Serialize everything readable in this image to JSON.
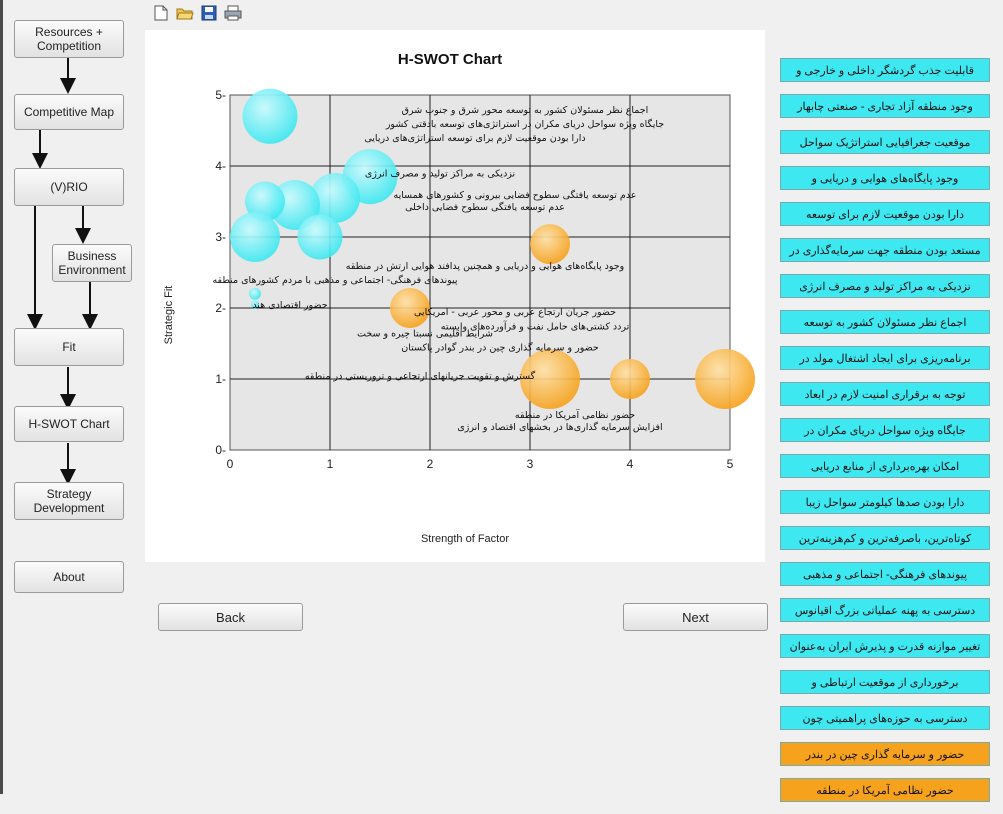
{
  "toolbar": {
    "icons": [
      "new-file-icon",
      "open-folder-icon",
      "save-icon",
      "print-icon"
    ]
  },
  "nav": {
    "resources": "Resources + Competition",
    "competitive_map": "Competitive Map",
    "vrio": "(V)RIO",
    "business_env": "Business Environment",
    "fit": "Fit",
    "hswot": "H-SWOT Chart",
    "strategy": "Strategy Development",
    "about": "About"
  },
  "buttons": {
    "back": "Back",
    "next": "Next"
  },
  "colors": {
    "cyan_bubble": "#3ee8f0",
    "orange_bubble": "#f6a21c",
    "plot_bg": "#e6e6e6"
  },
  "chart_data": {
    "type": "scatter",
    "title": "H-SWOT Chart",
    "xlabel": "Strength of Factor",
    "ylabel": "Strategic Fit",
    "xlim": [
      0,
      5
    ],
    "ylim": [
      0,
      5
    ],
    "xticks": [
      "0",
      "1",
      "2",
      "3",
      "4",
      "5"
    ],
    "yticks": [
      "0-",
      "1-",
      "2-",
      "3-",
      "4-",
      "5-"
    ],
    "grid": true,
    "points": [
      {
        "x": 0.4,
        "y": 4.7,
        "size": 0.55,
        "group": "cyan"
      },
      {
        "x": 1.4,
        "y": 3.85,
        "size": 0.55,
        "group": "cyan"
      },
      {
        "x": 1.05,
        "y": 3.55,
        "size": 0.5,
        "group": "cyan"
      },
      {
        "x": 0.65,
        "y": 3.45,
        "size": 0.5,
        "group": "cyan"
      },
      {
        "x": 0.35,
        "y": 3.5,
        "size": 0.4,
        "group": "cyan"
      },
      {
        "x": 0.25,
        "y": 3.0,
        "size": 0.5,
        "group": "cyan"
      },
      {
        "x": 0.9,
        "y": 3.0,
        "size": 0.45,
        "group": "cyan"
      },
      {
        "x": 0.25,
        "y": 2.2,
        "size": 0.12,
        "group": "cyan"
      },
      {
        "x": 0.25,
        "y": 2.05,
        "size": 0.08,
        "group": "cyan"
      },
      {
        "x": 3.2,
        "y": 2.9,
        "size": 0.4,
        "group": "orange"
      },
      {
        "x": 1.8,
        "y": 2.0,
        "size": 0.4,
        "group": "orange"
      },
      {
        "x": 3.2,
        "y": 1.0,
        "size": 0.6,
        "group": "orange"
      },
      {
        "x": 4.0,
        "y": 1.0,
        "size": 0.4,
        "group": "orange"
      },
      {
        "x": 4.95,
        "y": 1.0,
        "size": 0.6,
        "group": "orange"
      }
    ],
    "annotations": [
      {
        "text": "اجماع نظر مسئولان کشور به توسعه محور شرق و جنوب شرق",
        "x": 2.95,
        "y": 4.75
      },
      {
        "text": "جایگاه ویژه سواحل دریای مکران در استراتژی‌های توسعه بادقتی کشور",
        "x": 2.95,
        "y": 4.55
      },
      {
        "text": "دارا بودن موقعیت لازم برای توسعه استراتژی‌های دریایی",
        "x": 2.45,
        "y": 4.35
      },
      {
        "text": "نزدیکی به مراکز تولید و مصرف انرژی",
        "x": 2.1,
        "y": 3.85
      },
      {
        "text": "عدم توسعه یافتگی سطوح فضایی بیرونی و کشورهای همسایه",
        "x": 2.85,
        "y": 3.55
      },
      {
        "text": "عدم توسعه یافتگی سطوح فضایی داخلی",
        "x": 2.55,
        "y": 3.38
      },
      {
        "text": "وجود پایگاه‌های هوایی و دریایی و همچنین پدافند هوایی ارتش در منطقه",
        "x": 2.55,
        "y": 2.55
      },
      {
        "text": "پیوندهای فرهنگی- اجتماعی و مذهبی با مردم کشورهای منطقه",
        "x": 1.05,
        "y": 2.35
      },
      {
        "text": "حضور جریان ارتجاع عربی و محور عربی - امریکایی",
        "x": 2.85,
        "y": 1.9
      },
      {
        "text": "تردد کشتی‌های حامل نفت و فرآورده‌های وابسته",
        "x": 3.05,
        "y": 1.7
      },
      {
        "text": "حضور اقتصادی هند",
        "x": 0.6,
        "y": 2.0
      },
      {
        "text": "شرایط اقلیمی نسبتا چیره و سخت",
        "x": 1.95,
        "y": 1.6
      },
      {
        "text": "حضور و سرمایه گذاری چین در بندر گوادر پاکستان",
        "x": 2.7,
        "y": 1.4
      },
      {
        "text": "گسترش و تقویت جریانهای ارتجاعی و تروریستی در منطقه",
        "x": 1.9,
        "y": 1.0
      },
      {
        "text": "حضور نظامی آمریکا در منطقه",
        "x": 3.45,
        "y": 0.45
      },
      {
        "text": "افزایش سرمایه گذاری‌ها در بخشهای اقتصاد و انرژی",
        "x": 3.3,
        "y": 0.28
      }
    ]
  },
  "factors": [
    {
      "label": "قابلیت جذب گردشگر داخلی و خارجی و",
      "color": "cyan"
    },
    {
      "label": "وجود منطقه آزاد تجاری - صنعتی چابهار",
      "color": "cyan"
    },
    {
      "label": "موقعیت جغرافیایی استراتژیک سواحل",
      "color": "cyan"
    },
    {
      "label": "وجود پایگاه‌های هوایی و دریایی و",
      "color": "cyan"
    },
    {
      "label": "دارا بودن موقعیت لازم برای توسعه",
      "color": "cyan"
    },
    {
      "label": "مستعد بودن منطقه جهت سرمایه‌گذاری در",
      "color": "cyan"
    },
    {
      "label": "نزدیکی به مراکز تولید و مصرف انرژی",
      "color": "cyan"
    },
    {
      "label": "اجماع نظر مسئولان کشور به توسعه",
      "color": "cyan"
    },
    {
      "label": "برنامه‌ریزی برای ایجاد اشتغال مولد در",
      "color": "cyan"
    },
    {
      "label": "توجه به برقراری امنیت لازم در ابعاد",
      "color": "cyan"
    },
    {
      "label": "جایگاه ویژه سواحل دریای مکران در",
      "color": "cyan"
    },
    {
      "label": "امکان بهره‌برداری از منابع دریایی",
      "color": "cyan"
    },
    {
      "label": "دارا بودن صدها کیلومتر سواحل زیبا",
      "color": "cyan"
    },
    {
      "label": "کوتاه‌ترین، باصرفه‌ترین و کم‌هزینه‌ترین",
      "color": "cyan"
    },
    {
      "label": "پیوندهای فرهنگی- اجتماعی و مذهبی",
      "color": "cyan"
    },
    {
      "label": "دسترسی به پهنه عملیاتی بزرگ اقیانوس",
      "color": "cyan"
    },
    {
      "label": "تغییر موازنه قدرت و پذیرش ایران به‌عنوان",
      "color": "cyan"
    },
    {
      "label": "برخورداری از موقعیت ارتباطی و",
      "color": "cyan"
    },
    {
      "label": "دسترسی به حوزه‌های پراهمیتی چون",
      "color": "cyan"
    },
    {
      "label": "حضور و سرمایه گذاری چین در بندر",
      "color": "orange"
    },
    {
      "label": "حضور نظامی آمریکا در منطقه",
      "color": "orange"
    }
  ]
}
